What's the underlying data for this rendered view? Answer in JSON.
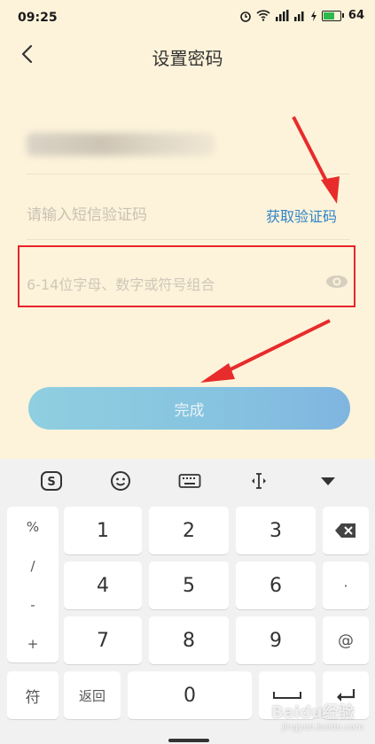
{
  "status_bar": {
    "time": "09:25",
    "battery": "64",
    "icons": [
      "alarm-icon",
      "wifi-icon",
      "signal-icon",
      "signal-2-icon",
      "charging-icon",
      "battery-icon"
    ]
  },
  "header": {
    "title": "设置密码",
    "back_icon": "chevron-left-icon"
  },
  "form": {
    "sms_placeholder": "请输入短信验证码",
    "get_code_label": "获取验证码",
    "password_placeholder": "6-14位字母、数字或符号组合",
    "submit_label": "完成"
  },
  "colors": {
    "accent": "#2f84c8",
    "highlight_border": "#e8232b",
    "background": "#fdf3da",
    "button_start": "#8fcfe0",
    "button_end": "#7fb5e0"
  },
  "keyboard": {
    "toolbar": [
      "sogou-logo-icon",
      "emoji-icon",
      "keyboard-icon",
      "cursor-move-icon",
      "collapse-icon"
    ],
    "side_symbols": [
      "%",
      "/",
      "-",
      "+"
    ],
    "rows": [
      [
        "1",
        "2",
        "3"
      ],
      [
        "4",
        "5",
        "6"
      ],
      [
        "7",
        "8",
        "9"
      ]
    ],
    "right_keys": [
      "backspace-icon",
      "·",
      "@",
      "enter-icon"
    ],
    "bottom": {
      "symbol_key": "符",
      "back_key": "返回",
      "zero": "0",
      "space": "space-icon"
    }
  },
  "watermark": {
    "text": "Baidu经验",
    "sub": "jingyan.baidu.com"
  }
}
